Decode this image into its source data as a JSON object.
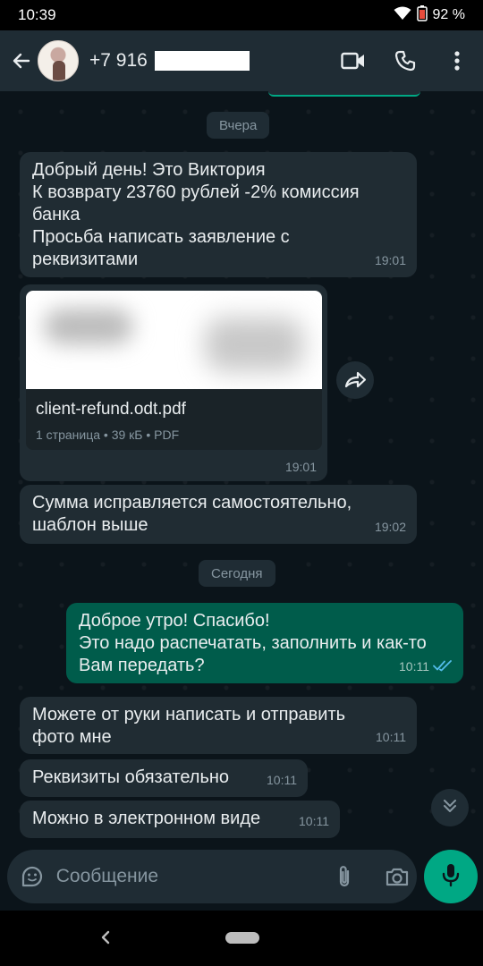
{
  "status_bar": {
    "time": "10:39",
    "battery": "92 %",
    "icons": [
      "wifi-icon",
      "battery-icon"
    ]
  },
  "header": {
    "contact": "+7 916",
    "icons": [
      "back-arrow-icon",
      "video-call-icon",
      "phone-icon",
      "more-vert-icon"
    ]
  },
  "chat": {
    "date_yesterday": "Вчера",
    "date_today": "Сегодня",
    "messages": [
      {
        "direction": "in",
        "text": "Добрый день! Это Виктория\nК возврату 23760 рублей -2% комиссия банка\nПросьба написать заявление с реквизитами",
        "time": "19:01"
      },
      {
        "direction": "in",
        "type": "document",
        "file_name": "client-refund.odt.pdf",
        "meta": "1 страница • 39 кБ • PDF",
        "time": "19:01"
      },
      {
        "direction": "in",
        "text": "Сумма исправляется самостоятельно, шаблон выше",
        "time": "19:02"
      },
      {
        "direction": "out",
        "text": "Доброе утро! Спасибо!\nЭто надо распечатать, заполнить и как-то Вам передать?",
        "time": "10:11",
        "status": "read"
      },
      {
        "direction": "in",
        "text": "Можете от руки написать и отправить фото мне",
        "time": "10:11"
      },
      {
        "direction": "in",
        "text": "Реквизиты обязательно",
        "time": "10:11"
      },
      {
        "direction": "in",
        "text": "Можно в электронном виде",
        "time": "10:11"
      }
    ]
  },
  "composer": {
    "placeholder": "Сообщение"
  },
  "colors": {
    "accent": "#00a884",
    "incoming": "#202c33",
    "outgoing": "#005c4b",
    "background": "#0b141a",
    "read_ticks": "#53bdeb"
  }
}
